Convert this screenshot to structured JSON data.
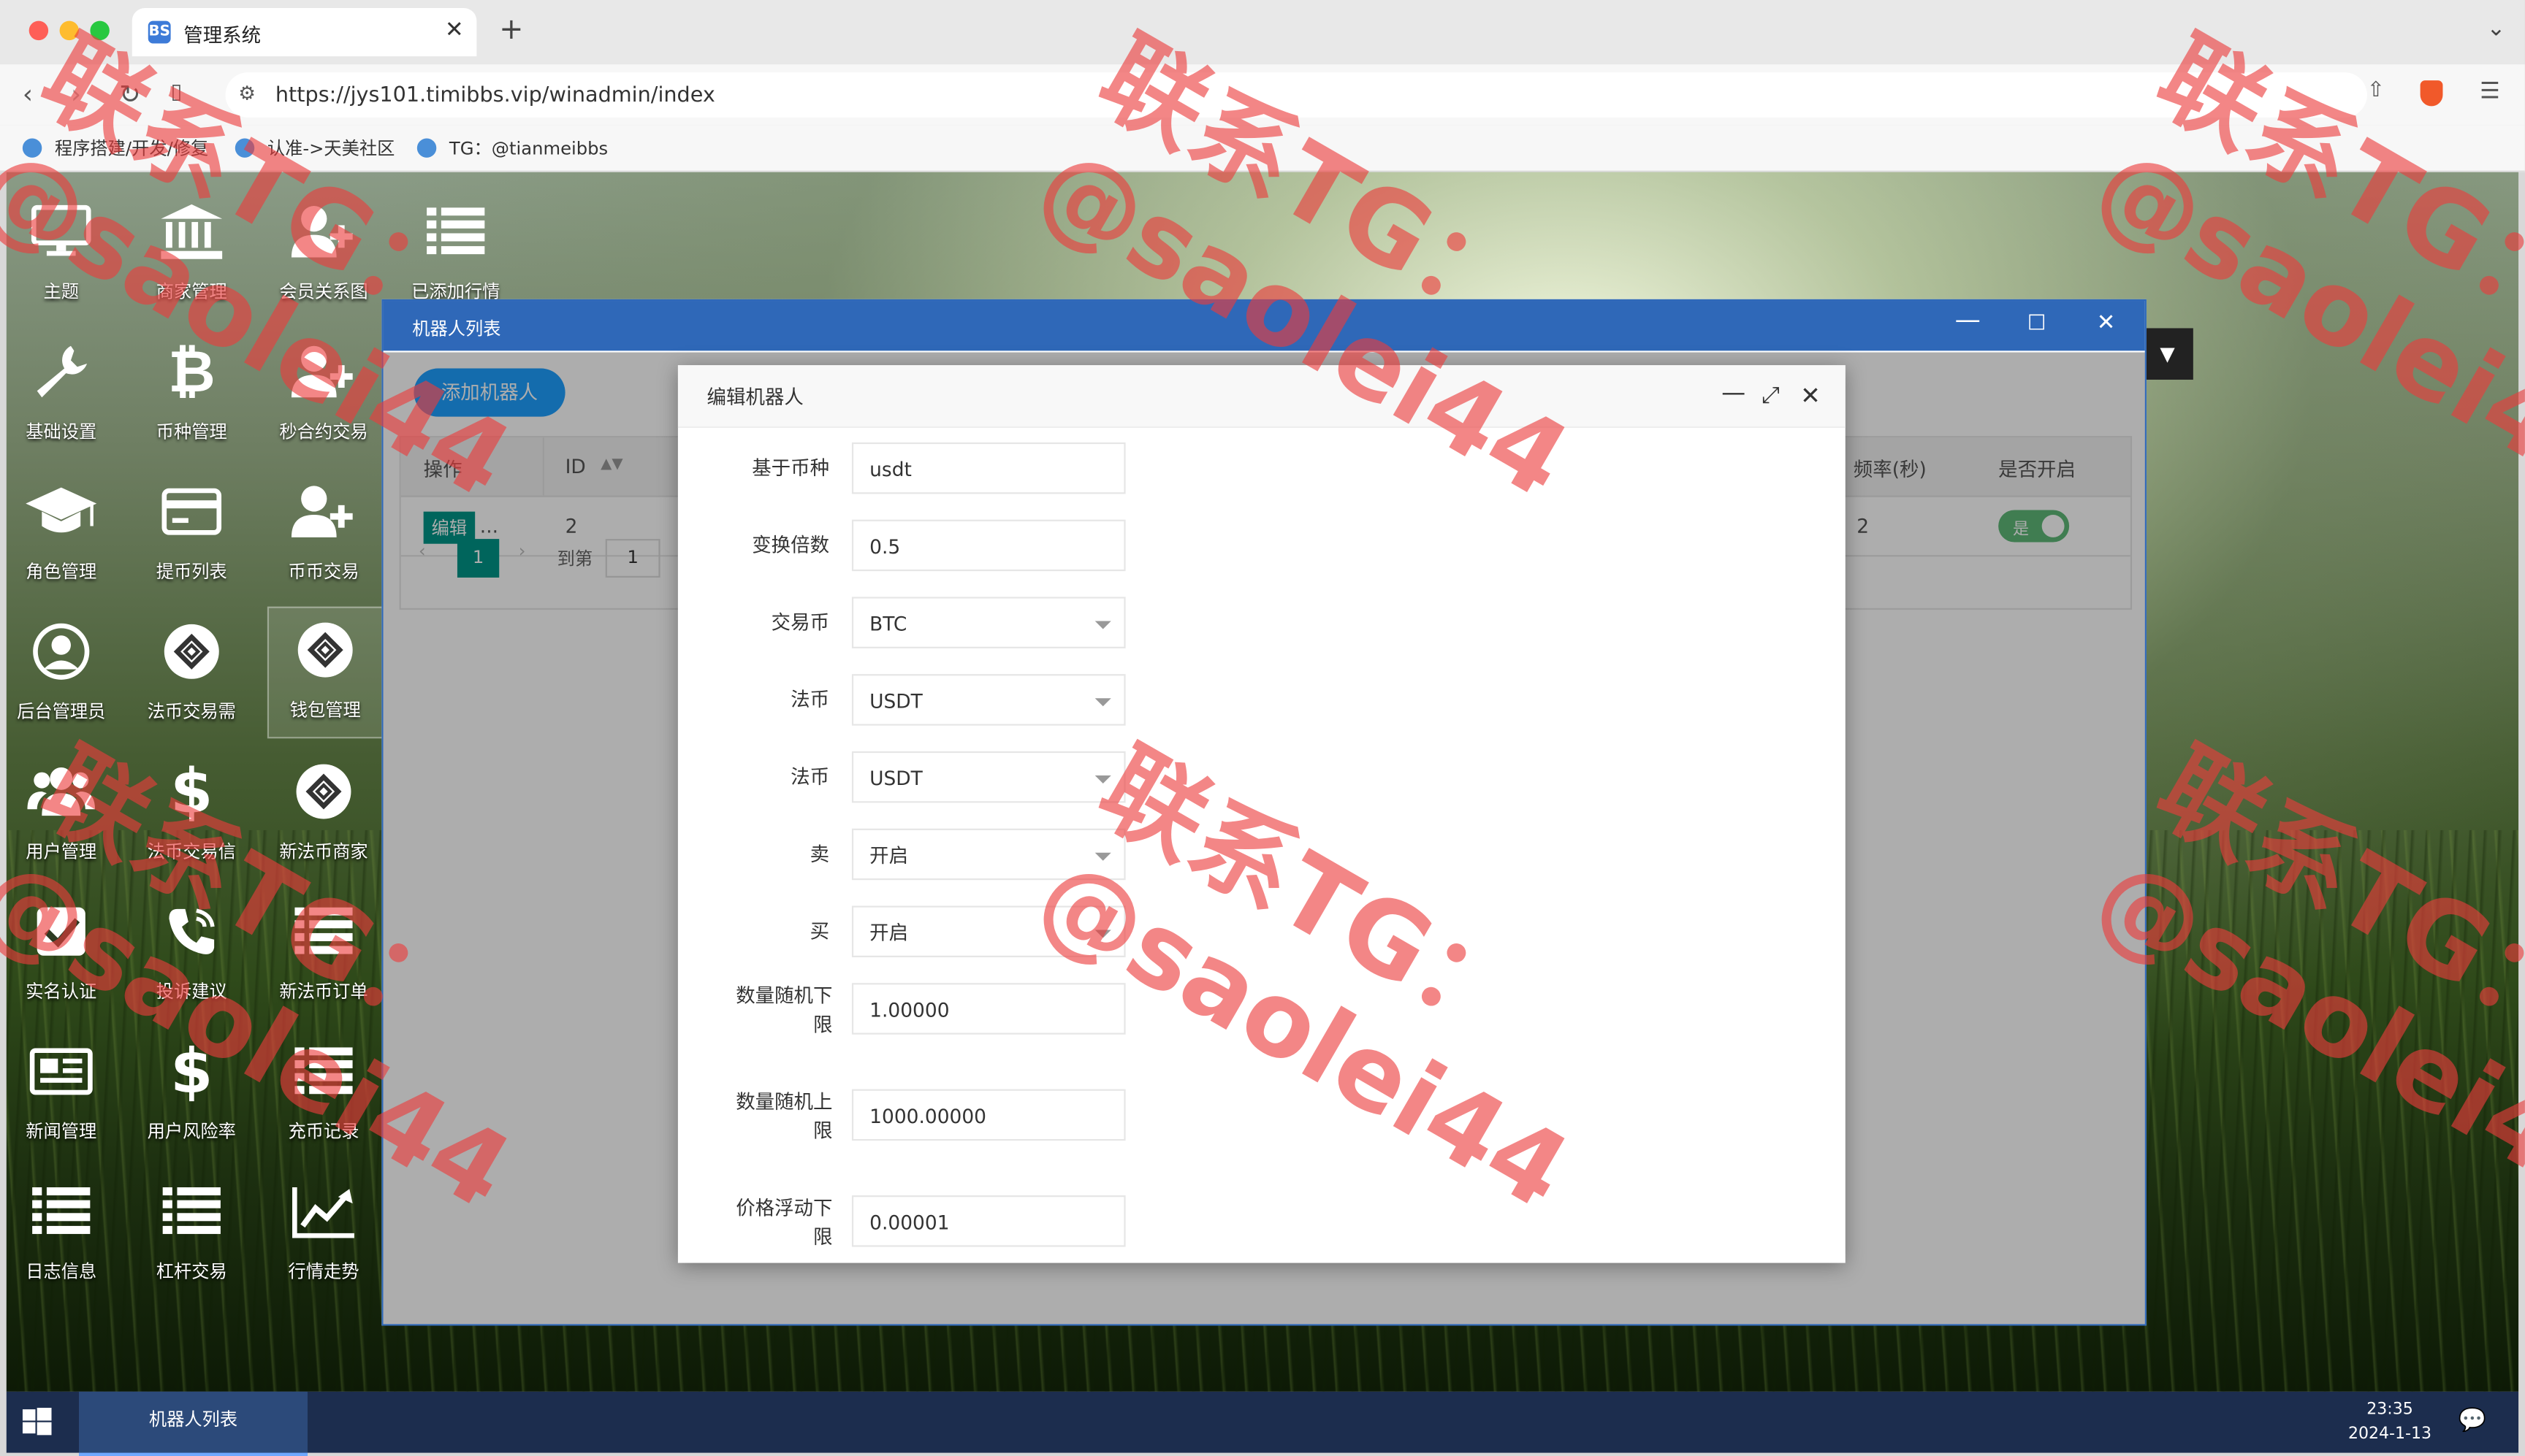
{
  "browser": {
    "tab_title": "管理系统",
    "tab_favicon": "BS",
    "url": "https://jys101.timibbs.vip/winadmin/index",
    "bookmarks": [
      {
        "label": "程序搭建/开发/修复"
      },
      {
        "label": "认准->天美社区"
      },
      {
        "label": "TG：@tianmeibbs"
      }
    ]
  },
  "desktop_icons": [
    {
      "label": "主题",
      "icon": "monitor-icon"
    },
    {
      "label": "商家管理",
      "icon": "bank-icon"
    },
    {
      "label": "会员关系图",
      "icon": "user-plus-icon"
    },
    {
      "label": "已添加行情",
      "icon": "list-icon"
    },
    {
      "label": "基础设置",
      "icon": "wrench-icon"
    },
    {
      "label": "币种管理",
      "icon": "bitcoin-icon"
    },
    {
      "label": "秒合约交易",
      "icon": "user-plus-icon"
    },
    {
      "label": "角色管理",
      "icon": "graduation-cap-icon"
    },
    {
      "label": "提币列表",
      "icon": "credit-card-icon"
    },
    {
      "label": "币币交易",
      "icon": "user-plus-icon"
    },
    {
      "label": "后台管理员",
      "icon": "user-circle-icon"
    },
    {
      "label": "法币交易需",
      "icon": "diamond-logo-icon"
    },
    {
      "label": "钱包管理",
      "icon": "diamond-logo-icon"
    },
    {
      "label": "用户管理",
      "icon": "users-icon"
    },
    {
      "label": "法币交易信",
      "icon": "dollar-icon"
    },
    {
      "label": "新法币商家",
      "icon": "diamond-logo-icon"
    },
    {
      "label": "实名认证",
      "icon": "check-square-icon"
    },
    {
      "label": "投诉建议",
      "icon": "phone-icon"
    },
    {
      "label": "新法币订单",
      "icon": "list-icon"
    },
    {
      "label": "新闻管理",
      "icon": "newspaper-icon"
    },
    {
      "label": "用户风险率",
      "icon": "dollar-icon"
    },
    {
      "label": "充币记录",
      "icon": "list-icon"
    },
    {
      "label": "日志信息",
      "icon": "list-icon"
    },
    {
      "label": "杠杆交易",
      "icon": "list-icon"
    },
    {
      "label": "行情走势",
      "icon": "line-chart-icon"
    }
  ],
  "robot_window": {
    "title": "机器人列表",
    "add_button": "添加机器人",
    "columns": {
      "op": "操作",
      "id": "ID",
      "freq": "频率(秒)",
      "enabled": "是否开启"
    },
    "row": {
      "edit": "编辑",
      "more": "...",
      "id": "2",
      "freq": "2",
      "enabled": "是"
    },
    "pager": {
      "page": "1",
      "goto": "到第",
      "input": "1"
    }
  },
  "edit_dialog": {
    "title": "编辑机器人",
    "fields": [
      {
        "label": "基于币种",
        "value": "usdt",
        "type": "text"
      },
      {
        "label": "变换倍数",
        "value": "0.5",
        "type": "text"
      },
      {
        "label": "交易币",
        "value": "BTC",
        "type": "select"
      },
      {
        "label": "法币",
        "value": "USDT",
        "type": "select"
      },
      {
        "label": "法币",
        "value": "USDT",
        "type": "select"
      },
      {
        "label": "卖",
        "value": "开启",
        "type": "select"
      },
      {
        "label": "买",
        "value": "开启",
        "type": "select"
      },
      {
        "label": "数量随机下限",
        "value": "1.00000",
        "type": "text"
      },
      {
        "label": "数量随机上限",
        "value": "1000.00000",
        "type": "text"
      },
      {
        "label": "价格浮动下限",
        "value": "0.00001",
        "type": "text"
      }
    ]
  },
  "taskbar": {
    "active_item": "机器人列表",
    "time": "23:35",
    "date": "2024-1-13"
  },
  "watermark": {
    "lines": [
      "联系TG：",
      "@saolei44"
    ],
    "color": "#eb3c3c"
  }
}
